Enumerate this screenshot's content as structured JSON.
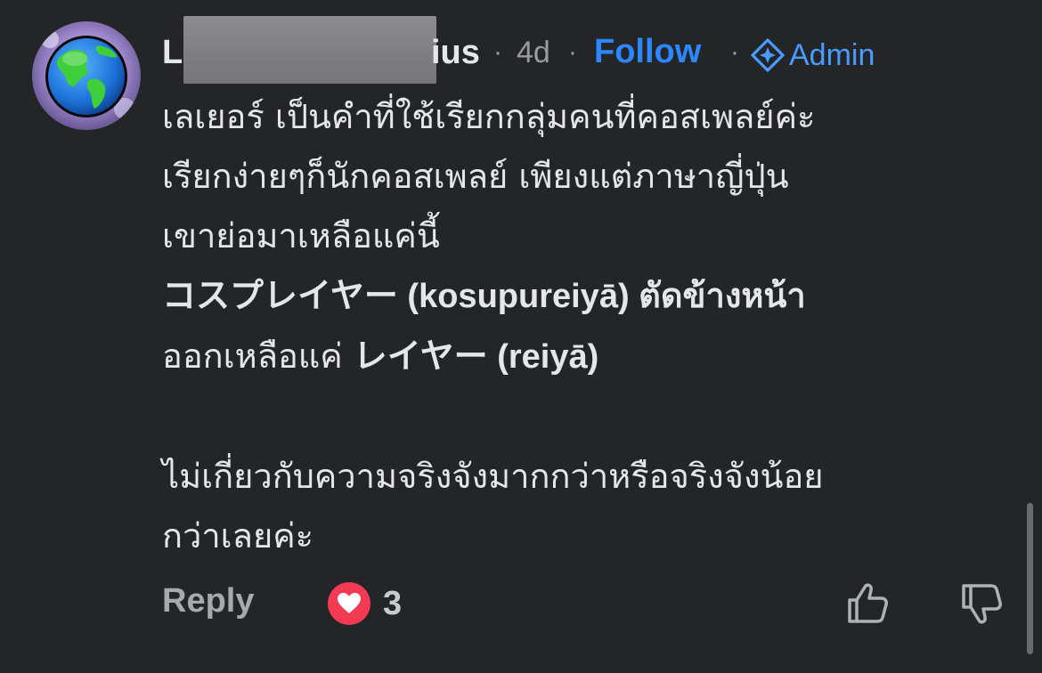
{
  "comment": {
    "author_visible_start": "L",
    "author_visible_end": "ius",
    "separator": "·",
    "time": "4d",
    "follow_label": "Follow",
    "badge_label": "Admin",
    "body": {
      "line1": "เลเยอร์ เป็นคำที่ใช้เรียกกลุ่มคนที่คอสเพลย์ค่ะ",
      "line2": "เรียกง่ายๆก็นักคอสเพลย์ เพียงแต่ภาษาญี่ปุ่น",
      "line3": "เขาย่อมาเหลือแค่นี้",
      "line4_ja": "コスプレイヤー",
      "line4_rest": " (kosupureiyā) ตัดข้างหน้า",
      "line5_start": "ออกเหลือแค่ ",
      "line5_ja": "レイヤー",
      "line5_rest": " (reiyā)",
      "line6": "ไม่เกี่ยวกับความจริงจังมากกว่าหรือจริงจังน้อย",
      "line7": "กว่าเลยค่ะ"
    },
    "actions": {
      "reply_label": "Reply",
      "reaction_count": "3"
    }
  },
  "colors": {
    "background": "#242527",
    "text": "#e4e6eb",
    "muted": "#9a9ba0",
    "link": "#2d88ff",
    "heart": "#f23a55"
  }
}
